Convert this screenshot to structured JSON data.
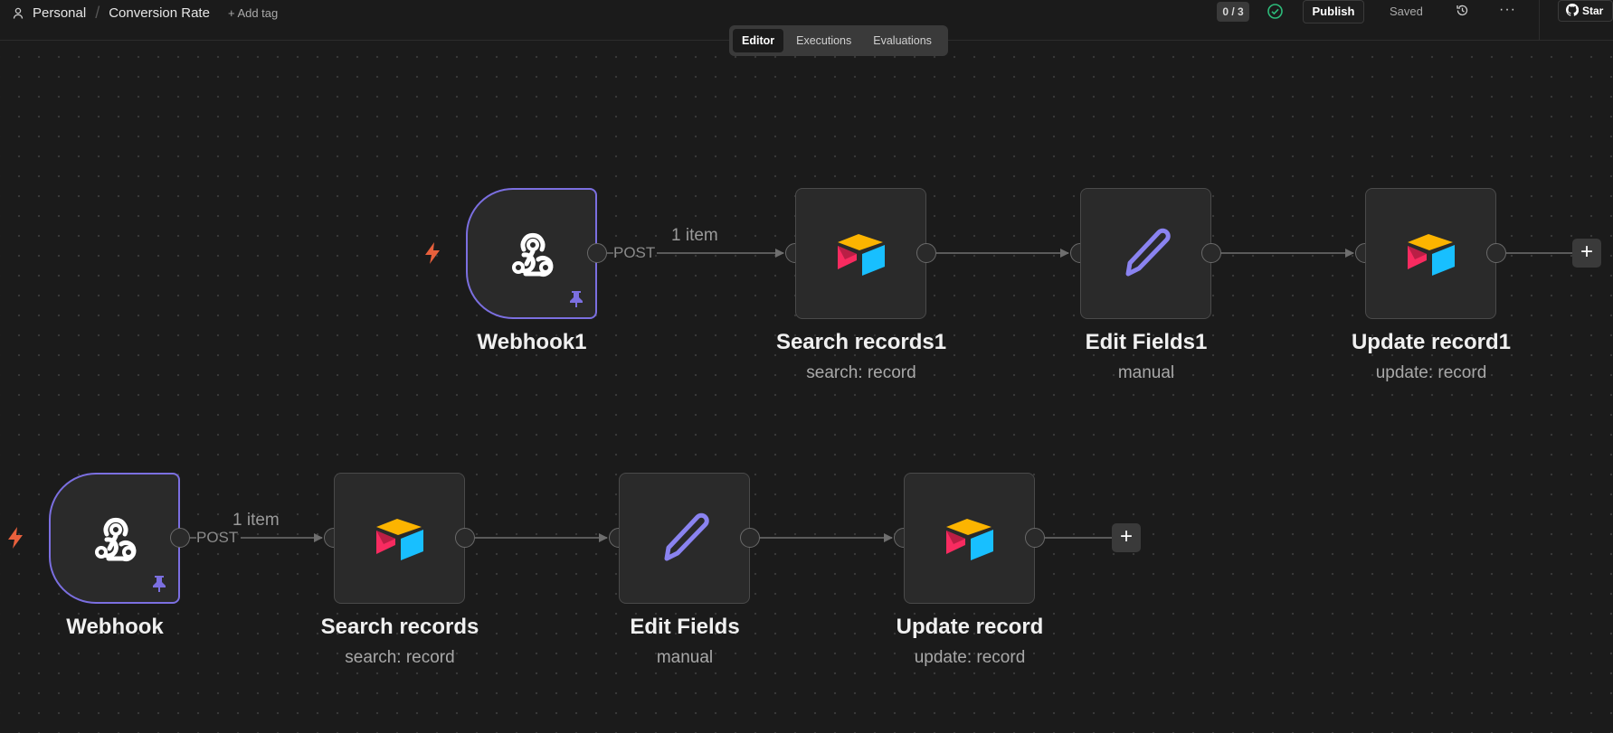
{
  "topbar": {
    "project": "Personal",
    "workflow_name": "Conversion Rate",
    "add_tag": "+ Add tag",
    "counter": "0 / 3",
    "publish": "Publish",
    "saved": "Saved",
    "more": "···",
    "star": "Star"
  },
  "tabs": [
    "Editor",
    "Executions",
    "Evaluations"
  ],
  "active_tab": "Editor",
  "workflow1": {
    "trigger": {
      "title": "Webhook1",
      "method": "POST",
      "items": "1 item",
      "icon": "webhook-icon"
    },
    "nodes": [
      {
        "title": "Search records1",
        "sub": "search: record",
        "icon": "airtable-icon"
      },
      {
        "title": "Edit Fields1",
        "sub": "manual",
        "icon": "pencil-icon"
      },
      {
        "title": "Update record1",
        "sub": "update: record",
        "icon": "airtable-icon"
      }
    ],
    "add": "+"
  },
  "workflow2": {
    "trigger": {
      "title": "Webhook",
      "method": "POST",
      "items": "1 item",
      "icon": "webhook-icon"
    },
    "nodes": [
      {
        "title": "Search records",
        "sub": "search: record",
        "icon": "airtable-icon"
      },
      {
        "title": "Edit Fields",
        "sub": "manual",
        "icon": "pencil-icon"
      },
      {
        "title": "Update record",
        "sub": "update: record",
        "icon": "airtable-icon"
      }
    ],
    "add": "+"
  },
  "colors": {
    "accent": "#7b6fe0",
    "bolt": "#e8603c",
    "airtable_yellow": "#fcb400",
    "airtable_red": "#f82b60",
    "airtable_blue": "#18bfff",
    "check_green": "#2dbb7a",
    "pencil": "#8a83f0"
  }
}
